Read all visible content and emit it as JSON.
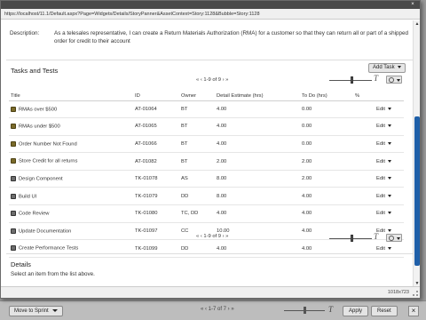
{
  "popup": {
    "url": "https://localhost/11.1/Default.aspx?Page=Widgets/Details/StoryPanner&AssetContext=Story:1128&Bubble=Story:1128",
    "close_label": "×"
  },
  "description": {
    "label": "Description:",
    "text": "As a telesales representative, I can create a Return Materials Authorization (RMA) for a customer so that they can return all or part of a shipped order for credit to their account"
  },
  "tasks": {
    "title": "Tasks and Tests",
    "add_button": "Add Task",
    "pager_top": "« ‹ 1-9 of 9 › »",
    "pager_bottom": "« ‹ 1-9 of 9 › »",
    "t_symbol": "T",
    "columns": [
      "Title",
      "ID",
      "Owner",
      "Detail Estimate (hrs)",
      "To Do (hrs)",
      "%"
    ],
    "rows": [
      {
        "icon": "story",
        "title": "RMAs over $500",
        "id": "AT-01064",
        "owner": "BT",
        "estimate": "4.00",
        "todo": "0.00",
        "pct": "",
        "edit": "Edit"
      },
      {
        "icon": "story",
        "title": "RMAs under $500",
        "id": "AT-01065",
        "owner": "BT",
        "estimate": "4.00",
        "todo": "0.00",
        "pct": "",
        "edit": "Edit"
      },
      {
        "icon": "story",
        "title": "Order Number Not Found",
        "id": "AT-01066",
        "owner": "BT",
        "estimate": "4.00",
        "todo": "0.00",
        "pct": "",
        "edit": "Edit"
      },
      {
        "icon": "story",
        "title": "Store Credit for all returns",
        "id": "AT-01082",
        "owner": "BT",
        "estimate": "2.00",
        "todo": "2.00",
        "pct": "",
        "edit": "Edit"
      },
      {
        "icon": "task",
        "title": "Design Component",
        "id": "TK-01078",
        "owner": "AS",
        "estimate": "8.00",
        "todo": "2.00",
        "pct": "",
        "edit": "Edit"
      },
      {
        "icon": "task",
        "title": "Build UI",
        "id": "TK-01079",
        "owner": "DD",
        "estimate": "8.00",
        "todo": "4.00",
        "pct": "",
        "edit": "Edit"
      },
      {
        "icon": "task",
        "title": "Code Review",
        "id": "TK-01080",
        "owner": "TC, DD",
        "estimate": "4.00",
        "todo": "4.00",
        "pct": "",
        "edit": "Edit"
      },
      {
        "icon": "task",
        "title": "Update Documentation",
        "id": "TK-01097",
        "owner": "CC",
        "estimate": "10.00",
        "todo": "4.00",
        "pct": "",
        "edit": "Edit"
      },
      {
        "icon": "task",
        "title": "Create Performance Tests",
        "id": "TK-01099",
        "owner": "DD",
        "estimate": "4.00",
        "todo": "4.00",
        "pct": "",
        "edit": "Edit"
      }
    ]
  },
  "details": {
    "title": "Details",
    "text": "Select an item from the list above."
  },
  "statusbar": {
    "size": "1018x723"
  },
  "background": {
    "move_label": "Move to Sprint",
    "pager": "« ‹ 1-7 of 7 › »",
    "t_symbol": "T",
    "apply_label": "Apply",
    "reset_label": "Reset",
    "close_label": "×"
  }
}
